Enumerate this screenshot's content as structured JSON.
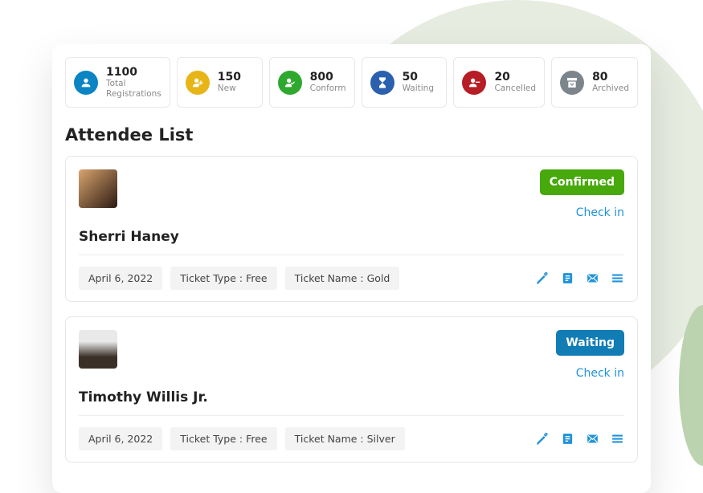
{
  "stats": [
    {
      "value": "1100",
      "label": "Total Registrations",
      "icon": "users",
      "color": "c-blue"
    },
    {
      "value": "150",
      "label": "New",
      "icon": "user-plus",
      "color": "c-yel"
    },
    {
      "value": "800",
      "label": "Conform",
      "icon": "user-check",
      "color": "c-grn"
    },
    {
      "value": "50",
      "label": "Waiting",
      "icon": "hourglass",
      "color": "c-mid"
    },
    {
      "value": "20",
      "label": "Cancelled",
      "icon": "user-minus",
      "color": "c-red"
    },
    {
      "value": "80",
      "label": "Archived",
      "icon": "archive",
      "color": "c-gray"
    }
  ],
  "title": "Attendee List",
  "attendees": [
    {
      "name": "Sherri Haney",
      "status": "Confirmed",
      "status_class": "b-conf",
      "checkin": "Check in",
      "date": "April 6, 2022",
      "ticket_type": "Ticket Type : Free",
      "ticket_name": "Ticket Name : Gold",
      "avatar": "a"
    },
    {
      "name": "Timothy Willis Jr.",
      "status": "Waiting",
      "status_class": "b-wait",
      "checkin": "Check in",
      "date": "April 6, 2022",
      "ticket_type": "Ticket Type : Free",
      "ticket_name": "Ticket Name : Silver",
      "avatar": "b"
    }
  ],
  "action_icons": [
    "edit",
    "doc",
    "mail",
    "list"
  ]
}
